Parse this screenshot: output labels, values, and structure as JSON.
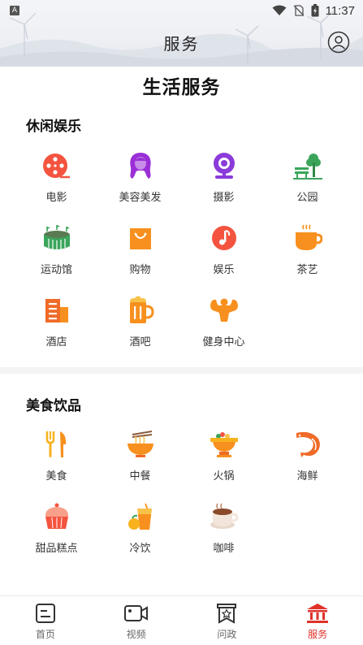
{
  "status_bar": {
    "badge": "A",
    "time": "11:37"
  },
  "header": {
    "title": "服务"
  },
  "page_heading": "生活服务",
  "sections": [
    {
      "title": "休闲娱乐",
      "items": [
        {
          "label": "电影",
          "icon": "film-reel-icon"
        },
        {
          "label": "美容美发",
          "icon": "hair-salon-icon"
        },
        {
          "label": "摄影",
          "icon": "webcam-icon"
        },
        {
          "label": "公园",
          "icon": "park-bench-icon"
        },
        {
          "label": "运动馆",
          "icon": "stadium-icon"
        },
        {
          "label": "购物",
          "icon": "shopping-bag-icon"
        },
        {
          "label": "娱乐",
          "icon": "music-note-icon"
        },
        {
          "label": "茶艺",
          "icon": "tea-cup-icon"
        },
        {
          "label": "酒店",
          "icon": "hotel-building-icon"
        },
        {
          "label": "酒吧",
          "icon": "beer-mug-icon"
        },
        {
          "label": "健身中心",
          "icon": "fitness-muscle-icon"
        }
      ]
    },
    {
      "title": "美食饮品",
      "items": [
        {
          "label": "美食",
          "icon": "fork-knife-icon"
        },
        {
          "label": "中餐",
          "icon": "noodle-bowl-icon"
        },
        {
          "label": "火锅",
          "icon": "hotpot-icon"
        },
        {
          "label": "海鲜",
          "icon": "shrimp-icon"
        },
        {
          "label": "甜品糕点",
          "icon": "cupcake-icon"
        },
        {
          "label": "冷饮",
          "icon": "cold-drink-icon"
        },
        {
          "label": "咖啡",
          "icon": "coffee-cup-icon"
        }
      ]
    }
  ],
  "tabbar": [
    {
      "label": "首页",
      "icon": "home-doc-icon",
      "active": false
    },
    {
      "label": "视频",
      "icon": "video-camera-icon",
      "active": false
    },
    {
      "label": "问政",
      "icon": "inquiry-bookmark-icon",
      "active": false
    },
    {
      "label": "服务",
      "icon": "service-hall-icon",
      "active": true
    }
  ],
  "colors": {
    "accent": "#e0322b",
    "icon_orange": "#f7901e",
    "icon_purple": "#9a2fd6",
    "icon_green": "#3aa55a",
    "icon_red": "#f4543f"
  }
}
